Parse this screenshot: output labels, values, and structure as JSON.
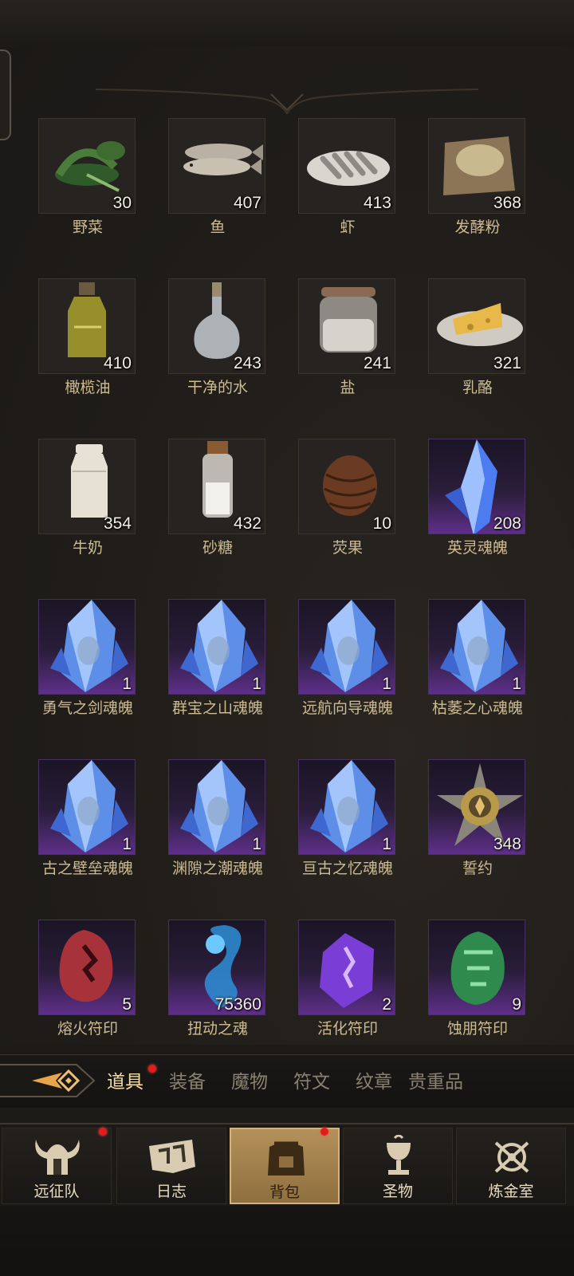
{
  "inventory": {
    "items": [
      {
        "name": "野菜",
        "count": "30",
        "icon": "greens-icon",
        "rarity": "normal"
      },
      {
        "name": "鱼",
        "count": "407",
        "icon": "fish-icon",
        "rarity": "normal"
      },
      {
        "name": "虾",
        "count": "413",
        "icon": "shrimp-icon",
        "rarity": "normal"
      },
      {
        "name": "发酵粉",
        "count": "368",
        "icon": "yeast-powder-icon",
        "rarity": "normal"
      },
      {
        "name": "橄榄油",
        "count": "410",
        "icon": "olive-oil-icon",
        "rarity": "normal"
      },
      {
        "name": "干净的水",
        "count": "243",
        "icon": "clean-water-icon",
        "rarity": "normal"
      },
      {
        "name": "盐",
        "count": "241",
        "icon": "salt-jar-icon",
        "rarity": "normal"
      },
      {
        "name": "乳酪",
        "count": "321",
        "icon": "cheese-icon",
        "rarity": "normal"
      },
      {
        "name": "牛奶",
        "count": "354",
        "icon": "milk-bottle-icon",
        "rarity": "normal"
      },
      {
        "name": "砂糖",
        "count": "432",
        "icon": "sugar-jar-icon",
        "rarity": "normal"
      },
      {
        "name": "荧果",
        "count": "10",
        "icon": "pinecone-fruit-icon",
        "rarity": "normal"
      },
      {
        "name": "英灵魂魄",
        "count": "208",
        "icon": "blue-crystal-icon",
        "rarity": "epic"
      },
      {
        "name": "勇气之剑魂魄",
        "count": "1",
        "icon": "soul-crystal-icon",
        "rarity": "epic"
      },
      {
        "name": "群宝之山魂魄",
        "count": "1",
        "icon": "soul-crystal-icon",
        "rarity": "epic"
      },
      {
        "name": "远航向导魂魄",
        "count": "1",
        "icon": "soul-crystal-icon",
        "rarity": "epic"
      },
      {
        "name": "枯萎之心魂魄",
        "count": "1",
        "icon": "soul-crystal-icon",
        "rarity": "epic"
      },
      {
        "name": "古之壁垒魂魄",
        "count": "1",
        "icon": "soul-crystal-icon",
        "rarity": "epic"
      },
      {
        "name": "渊隙之潮魂魄",
        "count": "1",
        "icon": "soul-crystal-icon",
        "rarity": "epic"
      },
      {
        "name": "亘古之忆魂魄",
        "count": "1",
        "icon": "soul-crystal-icon",
        "rarity": "epic"
      },
      {
        "name": "誓约",
        "count": "348",
        "icon": "star-medal-icon",
        "rarity": "epic"
      },
      {
        "name": "熔火符印",
        "count": "5",
        "icon": "red-rune-stone-icon",
        "rarity": "epic"
      },
      {
        "name": "扭动之魂",
        "count": "75360",
        "icon": "blue-wisp-icon",
        "rarity": "epic"
      },
      {
        "name": "活化符印",
        "count": "2",
        "icon": "purple-rune-stone-icon",
        "rarity": "epic"
      },
      {
        "name": "蚀朋符印",
        "count": "9",
        "icon": "green-rune-stone-icon",
        "rarity": "epic"
      }
    ]
  },
  "category_tabs": [
    {
      "label": "道具",
      "active": true,
      "badge": true
    },
    {
      "label": "装备",
      "active": false,
      "badge": false
    },
    {
      "label": "魔物",
      "active": false,
      "badge": false
    },
    {
      "label": "符文",
      "active": false,
      "badge": false
    },
    {
      "label": "纹章",
      "active": false,
      "badge": false
    },
    {
      "label": "贵重品",
      "active": false,
      "badge": false
    }
  ],
  "bottom_nav": [
    {
      "label": "远征队",
      "icon": "horned-helmet-icon",
      "badge": true,
      "active": false
    },
    {
      "label": "日志",
      "icon": "scroll-banner-icon",
      "badge": false,
      "active": false
    },
    {
      "label": "背包",
      "icon": "backpack-icon",
      "badge": true,
      "active": true
    },
    {
      "label": "圣物",
      "icon": "chalice-icon",
      "badge": false,
      "active": false
    },
    {
      "label": "炼金室",
      "icon": "alchemy-icon",
      "badge": false,
      "active": false
    }
  ],
  "colors": {
    "background": "#1d1b18",
    "item_name": "#cdbb92",
    "epic_slot": "#5e2f8a",
    "active_nav": "#b4915a",
    "badge": "#e21b1b"
  }
}
